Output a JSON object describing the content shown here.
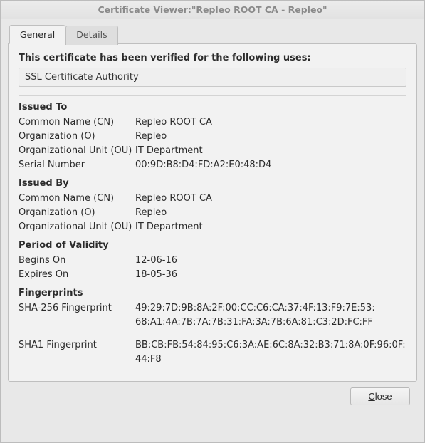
{
  "window": {
    "title": "Certificate Viewer:\"Repleo ROOT CA - Repleo\""
  },
  "tabs": {
    "general": "General",
    "details": "Details"
  },
  "verified_lead": "This certificate has been verified for the following uses:",
  "uses": "SSL Certificate Authority",
  "issued_to": {
    "heading": "Issued To",
    "cn_label": "Common Name (CN)",
    "cn_value": "Repleo ROOT CA",
    "o_label": "Organization (O)",
    "o_value": "Repleo",
    "ou_label": "Organizational Unit (OU)",
    "ou_value": "IT Department",
    "serial_label": "Serial Number",
    "serial_value": "00:9D:B8:D4:FD:A2:E0:48:D4"
  },
  "issued_by": {
    "heading": "Issued By",
    "cn_label": "Common Name (CN)",
    "cn_value": "Repleo ROOT CA",
    "o_label": "Organization (O)",
    "o_value": "Repleo",
    "ou_label": "Organizational Unit (OU)",
    "ou_value": "IT Department"
  },
  "validity": {
    "heading": "Period of Validity",
    "begins_label": "Begins On",
    "begins_value": "12-06-16",
    "expires_label": "Expires On",
    "expires_value": "18-05-36"
  },
  "fingerprints": {
    "heading": "Fingerprints",
    "sha256_label": "SHA-256 Fingerprint",
    "sha256_line1": "49:29:7D:9B:8A:2F:00:CC:C6:CA:37:4F:13:F9:7E:53:",
    "sha256_line2": "68:A1:4A:7B:7A:7B:31:FA:3A:7B:6A:81:C3:2D:FC:FF",
    "sha1_label": "SHA1 Fingerprint",
    "sha1_value": "BB:CB:FB:54:84:95:C6:3A:AE:6C:8A:32:B3:71:8A:0F:96:0F:44:F8"
  },
  "buttons": {
    "close": "Close",
    "close_accel": "C"
  }
}
